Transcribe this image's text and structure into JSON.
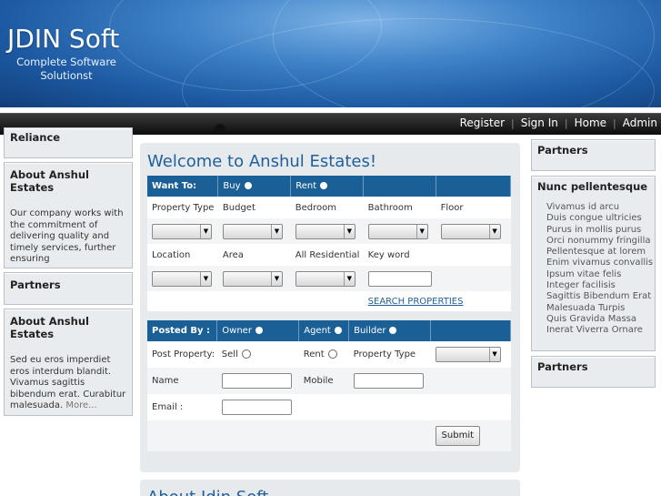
{
  "header": {
    "title": "JDIN Soft",
    "tagline": "Complete Software Solutionst"
  },
  "nav": {
    "register": "Register",
    "sign_in": "Sign In",
    "home": "Home",
    "admin": "Admin",
    "separator": "|"
  },
  "left": {
    "partial_title": "Reliance",
    "box1": {
      "title": "About Anshul Estates",
      "text": "Our company works with the commitment of delivering quality and timely services, further ensuring"
    },
    "box2": {
      "title": "Partners"
    },
    "box3": {
      "title": "About Anshul Estates",
      "text": "Sed eu eros imperdiet eros interdum blandit. Vivamus sagittis bibendum erat. Curabitur malesuada.",
      "more": "More..."
    }
  },
  "center": {
    "title": "Welcome to Anshul Estates!",
    "search": {
      "want_to": "Want To:",
      "buy": "Buy",
      "rent": "Rent",
      "labels1": [
        "Property Type",
        "Budget",
        "Bedroom",
        "Bathroom",
        "Floor"
      ],
      "labels2": [
        "Location",
        "Area",
        "All Residential",
        "Key word"
      ],
      "search_link": "SEARCH PROPERTIES"
    },
    "post": {
      "posted_by": "Posted By :",
      "owner": "Owner",
      "agent": "Agent",
      "builder": "Builder",
      "post_property": "Post Property:",
      "sell": "Sell",
      "rent": "Rent",
      "property_type": "Property Type",
      "name": "Name",
      "mobile": "Mobile",
      "email": "Email :",
      "submit": "Submit"
    },
    "title2": "About Jdin Soft"
  },
  "right": {
    "box1": {
      "title": "Partners"
    },
    "box2": {
      "title": "Nunc pellentesque",
      "items": [
        "Vivamus id arcu",
        "Duis congue ultricies",
        "Purus in mollis purus",
        "Orci nonummy fringilla",
        "Pellentesque at lorem",
        "Enim vivamus convallis",
        "Ipsum vitae felis",
        "Integer facilisis",
        "Sagittis Bibendum Erat",
        "Malesuada Turpis",
        "Quis Gravida Massa",
        "Inerat Viverra Ornare"
      ]
    },
    "box3": {
      "title": "Partners"
    }
  },
  "colors": {
    "accent": "#1a5f96",
    "link": "#1f5f9a"
  }
}
